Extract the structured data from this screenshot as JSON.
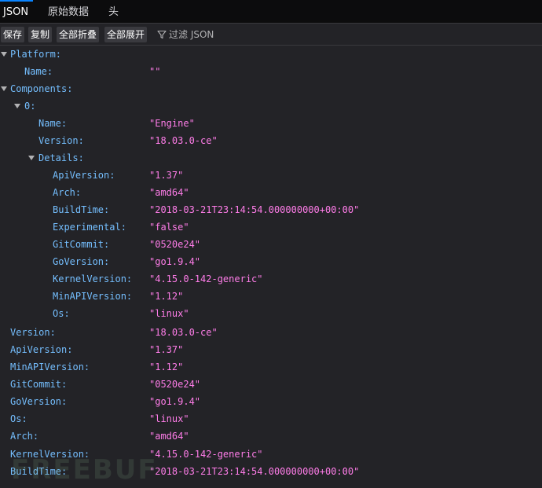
{
  "tabs": [
    {
      "label": "JSON"
    },
    {
      "label": "原始数据"
    },
    {
      "label": "头"
    }
  ],
  "toolbar": {
    "save": "保存",
    "copy": "复制",
    "collapse_all": "全部折叠",
    "expand_all": "全部展开",
    "filter_placeholder": "过滤 JSON",
    "filter_icon": "filter-icon"
  },
  "tree": {
    "platform_key": "Platform:",
    "platform_name_key": "Name:",
    "platform_name_val": "\"\"",
    "components_key": "Components:",
    "component0_key": "0:",
    "c_name_key": "Name:",
    "c_name_val": "\"Engine\"",
    "c_version_key": "Version:",
    "c_version_val": "\"18.03.0-ce\"",
    "details_key": "Details:",
    "details": [
      {
        "key": "ApiVersion:",
        "val": "\"1.37\""
      },
      {
        "key": "Arch:",
        "val": "\"amd64\""
      },
      {
        "key": "BuildTime:",
        "val": "\"2018-03-21T23:14:54.000000000+00:00\""
      },
      {
        "key": "Experimental:",
        "val": "\"false\""
      },
      {
        "key": "GitCommit:",
        "val": "\"0520e24\""
      },
      {
        "key": "GoVersion:",
        "val": "\"go1.9.4\""
      },
      {
        "key": "KernelVersion:",
        "val": "\"4.15.0-142-generic\""
      },
      {
        "key": "MinAPIVersion:",
        "val": "\"1.12\""
      },
      {
        "key": "Os:",
        "val": "\"linux\""
      }
    ],
    "top": [
      {
        "key": "Version:",
        "val": "\"18.03.0-ce\""
      },
      {
        "key": "ApiVersion:",
        "val": "\"1.37\""
      },
      {
        "key": "MinAPIVersion:",
        "val": "\"1.12\""
      },
      {
        "key": "GitCommit:",
        "val": "\"0520e24\""
      },
      {
        "key": "GoVersion:",
        "val": "\"go1.9.4\""
      },
      {
        "key": "Os:",
        "val": "\"linux\""
      },
      {
        "key": "Arch:",
        "val": "\"amd64\""
      },
      {
        "key": "KernelVersion:",
        "val": "\"4.15.0-142-generic\""
      },
      {
        "key": "BuildTime:",
        "val": "\"2018-03-21T23:14:54.000000000+00:00\""
      }
    ]
  },
  "watermark": "FREEBUF",
  "colors": {
    "key": "#75bfff",
    "string_value": "#ff7de9",
    "accent_tab": "#0a84ff"
  }
}
